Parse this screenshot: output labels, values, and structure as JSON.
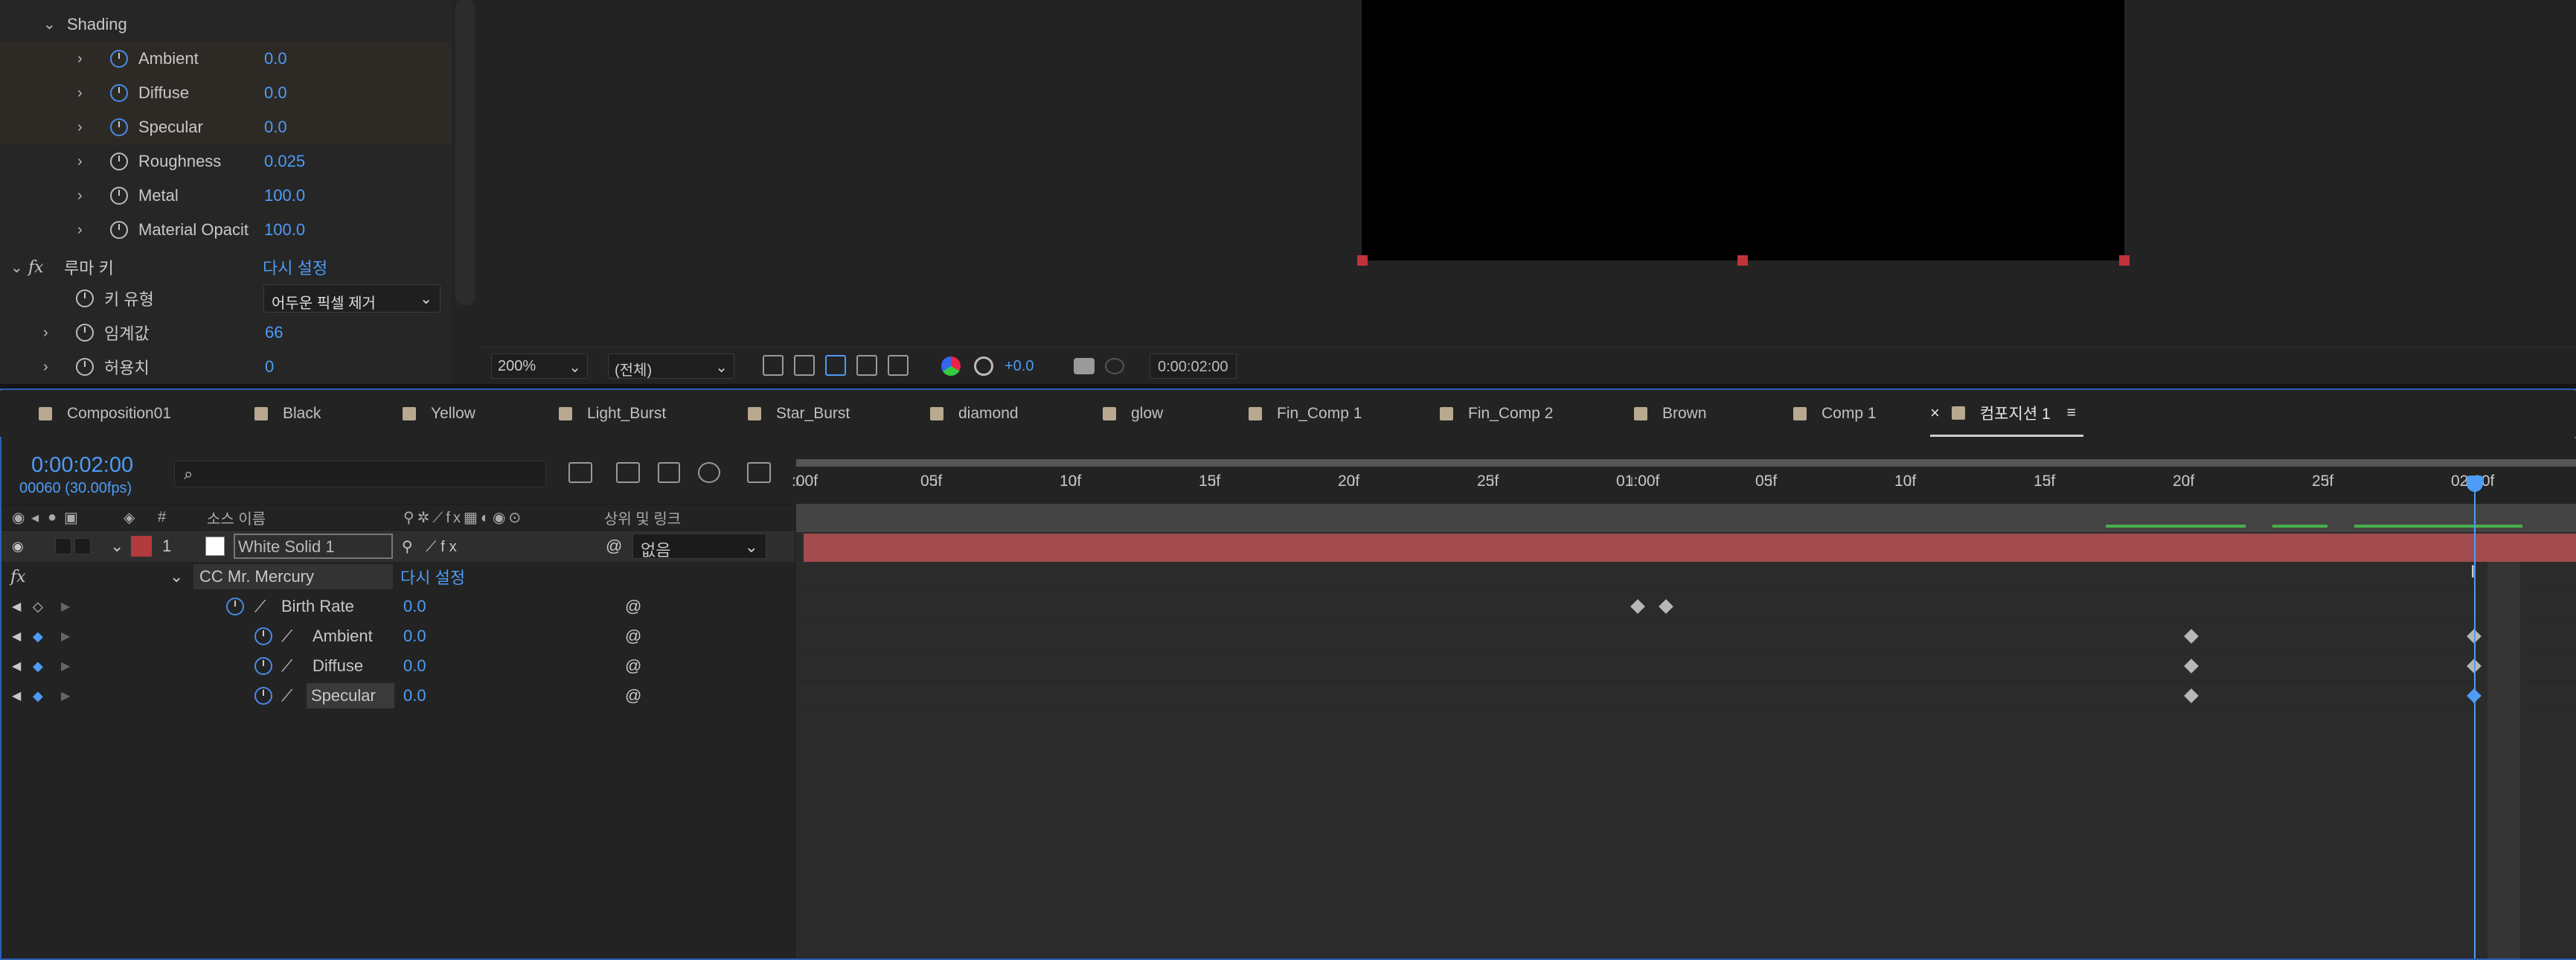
{
  "effect_controls": {
    "shading_label": "Shading",
    "properties": [
      {
        "name": "Ambient",
        "value": "0.0",
        "animated": true
      },
      {
        "name": "Diffuse",
        "value": "0.0",
        "animated": true
      },
      {
        "name": "Specular",
        "value": "0.0",
        "animated": true
      },
      {
        "name": "Roughness",
        "value": "0.025",
        "animated": false
      },
      {
        "name": "Metal",
        "value": "100.0",
        "animated": false
      },
      {
        "name": "Material Opacit",
        "value": "100.0",
        "animated": false
      }
    ],
    "fx_icon": "fx",
    "luma_key": {
      "name": "루마 키",
      "reset": "다시 설정"
    },
    "key_type": {
      "label": "키 유형",
      "value": "어두운 픽셀 제거"
    },
    "threshold": {
      "label": "임계값",
      "value": "66"
    },
    "tolerance": {
      "label": "허용치",
      "value": "0"
    }
  },
  "viewer_bar": {
    "zoom": "200%",
    "resolution": "(전체)",
    "exposure": "+0.0",
    "timecode": "0:00:02:00"
  },
  "tabs": [
    "Composition01",
    "Black",
    "Yellow",
    "Light_Burst",
    "Star_Burst",
    "diamond",
    "glow",
    "Fin_Comp 1",
    "Fin_Comp 2",
    "Brown",
    "Comp 1",
    "컴포지션 1"
  ],
  "active_tab": "컴포지션 1",
  "timeline": {
    "current_time": "0:00:02:00",
    "frame_info": "00060 (30.00fps)",
    "search_placeholder": "",
    "col_number": "#",
    "col_source": "소스 이름",
    "col_parent": "상위 및 링크",
    "layer": {
      "number": "1",
      "name": "White Solid 1",
      "parent": "없음"
    },
    "effect": {
      "name": "CC Mr. Mercury",
      "reset": "다시 설정"
    },
    "effect_props": [
      {
        "name": "Birth Rate",
        "value": "0.0"
      },
      {
        "name": "Ambient",
        "value": "0.0"
      },
      {
        "name": "Diffuse",
        "value": "0.0"
      },
      {
        "name": "Specular",
        "value": "0.0"
      }
    ],
    "ruler": [
      ":00f",
      "05f",
      "10f",
      "15f",
      "20f",
      "25f",
      "01:00f",
      "05f",
      "10f",
      "15f",
      "20f",
      "25f",
      "02:00f"
    ]
  },
  "colors": {
    "accent": "#4d9cf6",
    "layer_bar": "#a24b4e",
    "label_red": "#c0333b"
  }
}
